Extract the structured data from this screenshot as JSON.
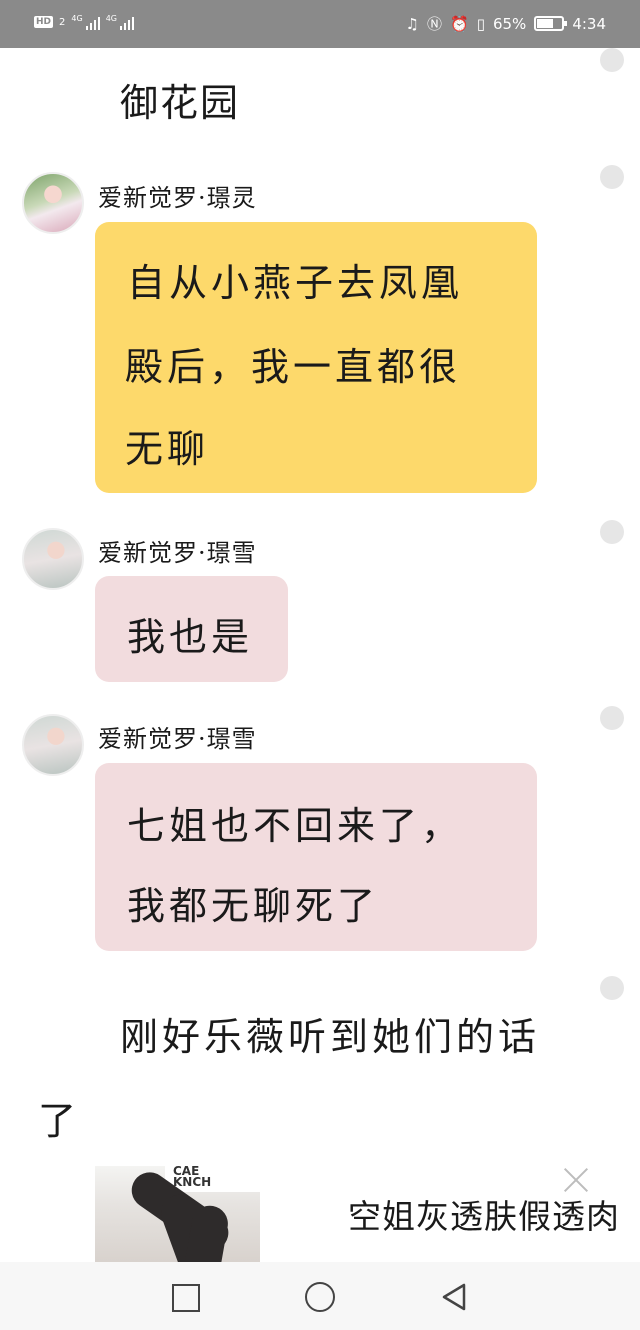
{
  "status_bar": {
    "hd_label": "HD",
    "sim_label": "2",
    "network_1": "4G",
    "network_2": "4G",
    "battery_percent": "65%",
    "battery_level": 0.65,
    "time": "4:34"
  },
  "scene_title": "御花园",
  "messages": [
    {
      "sender": "爱新觉罗·璟灵",
      "bubble_color": "#fdd96b",
      "lines": [
        "自从小燕子去凤凰",
        "殿后，我一直都很",
        "无聊"
      ]
    },
    {
      "sender": "爱新觉罗·璟雪",
      "bubble_color": "#f2dcde",
      "lines": [
        "我也是"
      ]
    },
    {
      "sender": "爱新觉罗·璟雪",
      "bubble_color": "#f2dcde",
      "lines": [
        "七姐也不回来了，",
        "我都无聊死了"
      ]
    }
  ],
  "narration": {
    "line1": "刚好乐薇听到她们的话",
    "line2": "了"
  },
  "ad": {
    "title": "空姐灰透肤假透肉",
    "image_text": "CAE\nKNCH",
    "image_icon": "stockings-photo-icon",
    "close_icon": "close-icon"
  },
  "nav_bar": {
    "recent_icon": "square-icon",
    "home_icon": "circle-icon",
    "back_icon": "triangle-back-icon"
  }
}
